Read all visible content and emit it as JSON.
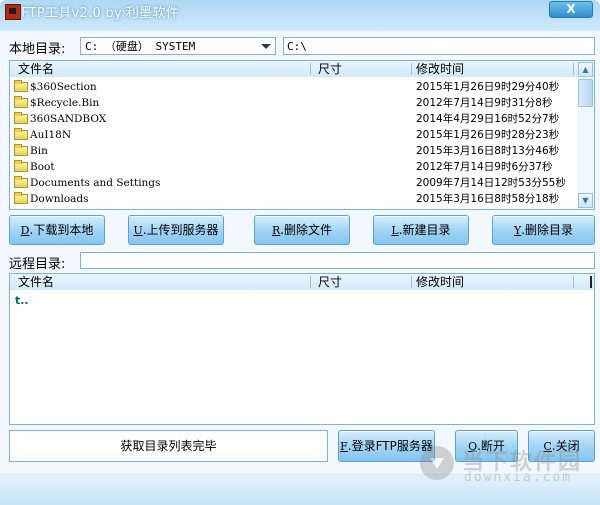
{
  "window": {
    "title": "FTP工具v2.0  by:利墨软件",
    "close_label": "X"
  },
  "local": {
    "label": "本地目录:",
    "drive_selected": "C: （硬盘） SYSTEM",
    "path": "C:\\",
    "columns": [
      "文件名",
      "尺寸",
      "修改时间"
    ],
    "rows": [
      {
        "name": "$360Section",
        "size": "",
        "time": "2015年1月26日9时29分40秒"
      },
      {
        "name": "$Recycle.Bin",
        "size": "",
        "time": "2012年7月14日9时31分8秒"
      },
      {
        "name": "360SANDBOX",
        "size": "",
        "time": "2014年4月29日16时52分7秒"
      },
      {
        "name": "AuI18N",
        "size": "",
        "time": "2015年1月26日9时28分23秒"
      },
      {
        "name": "Bin",
        "size": "",
        "time": "2015年3月16日8时13分46秒"
      },
      {
        "name": "Boot",
        "size": "",
        "time": "2012年7月14日9时6分37秒"
      },
      {
        "name": "Documents and Settings",
        "size": "",
        "time": "2009年7月14日12时53分55秒"
      },
      {
        "name": "Downloads",
        "size": "",
        "time": "2015年3月16日8时58分18秒"
      }
    ]
  },
  "actions": {
    "download": {
      "key": "D",
      "label": ".下载到本地"
    },
    "upload": {
      "key": "U",
      "label": ".上传到服务器"
    },
    "delete_file": {
      "key": "R",
      "label": ".删除文件"
    },
    "new_dir": {
      "key": "L",
      "label": ".新建目录"
    },
    "delete_dir": {
      "key": "Y",
      "label": ".删除目录"
    }
  },
  "remote": {
    "label": "远程目录:",
    "path": "",
    "columns": [
      "文件名",
      "尺寸",
      "修改时间"
    ],
    "updir_label": "t.."
  },
  "status": {
    "text": "获取目录列表完毕"
  },
  "footer_buttons": {
    "login": {
      "key": "F",
      "label": ".登录FTP服务器"
    },
    "disconnect": {
      "key": "Q",
      "label": ".断开"
    },
    "close": {
      "key": "C",
      "label": ".关闭"
    }
  },
  "watermark": {
    "text": "当下软件园",
    "sub": "downxia.com"
  }
}
